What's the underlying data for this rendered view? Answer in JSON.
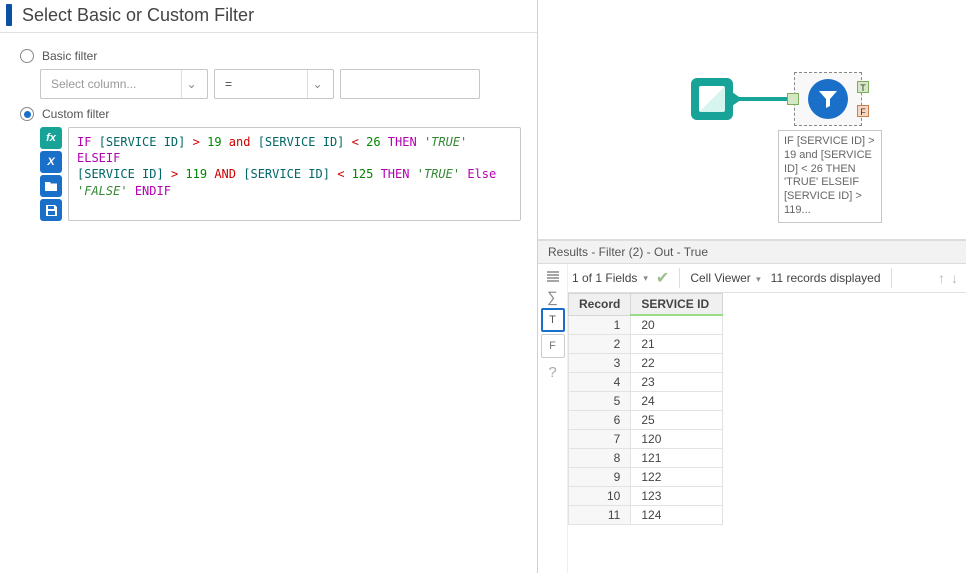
{
  "panel": {
    "title": "Select Basic or Custom Filter",
    "basic_label": "Basic filter",
    "custom_label": "Custom filter",
    "col_placeholder": "Select column...",
    "op_value": "=",
    "expr_tokens": [
      {
        "t": "kw",
        "v": "IF"
      },
      {
        "t": "sp"
      },
      {
        "t": "fldref",
        "v": "[SERVICE ID]"
      },
      {
        "t": "sp"
      },
      {
        "t": "op-t",
        "v": ">"
      },
      {
        "t": "sp"
      },
      {
        "t": "num",
        "v": "19"
      },
      {
        "t": "sp"
      },
      {
        "t": "op-t",
        "v": "and"
      },
      {
        "t": "sp"
      },
      {
        "t": "fldref",
        "v": "[SERVICE ID]"
      },
      {
        "t": "sp"
      },
      {
        "t": "op-t",
        "v": "<"
      },
      {
        "t": "sp"
      },
      {
        "t": "num",
        "v": "26"
      },
      {
        "t": "sp"
      },
      {
        "t": "kw",
        "v": "THEN"
      },
      {
        "t": "sp"
      },
      {
        "t": "str",
        "v": "'TRUE'"
      },
      {
        "t": "sp"
      },
      {
        "t": "kw",
        "v": "ELSEIF"
      },
      {
        "t": "br"
      },
      {
        "t": "fldref",
        "v": "[SERVICE ID]"
      },
      {
        "t": "sp"
      },
      {
        "t": "op-t",
        "v": ">"
      },
      {
        "t": "sp"
      },
      {
        "t": "num",
        "v": "119"
      },
      {
        "t": "sp"
      },
      {
        "t": "op-t",
        "v": "AND"
      },
      {
        "t": "sp"
      },
      {
        "t": "fldref",
        "v": "[SERVICE ID]"
      },
      {
        "t": "sp"
      },
      {
        "t": "op-t",
        "v": "<"
      },
      {
        "t": "sp"
      },
      {
        "t": "num",
        "v": "125"
      },
      {
        "t": "sp"
      },
      {
        "t": "kw",
        "v": "THEN"
      },
      {
        "t": "sp"
      },
      {
        "t": "str",
        "v": "'TRUE'"
      },
      {
        "t": "sp"
      },
      {
        "t": "kw",
        "v": "Else"
      },
      {
        "t": "br"
      },
      {
        "t": "str",
        "v": "'FALSE'"
      },
      {
        "t": "sp"
      },
      {
        "t": "kw",
        "v": "ENDIF"
      }
    ]
  },
  "canvas": {
    "filter_caption": "IF [SERVICE ID] > 19 and [SERVICE ID] < 26 THEN 'TRUE' ELSEIF [SERVICE ID] > 119...",
    "anchor_t": "T",
    "anchor_f": "F"
  },
  "results": {
    "header": "Results - Filter (2) - Out - True",
    "fields_info": "1 of 1 Fields",
    "cell_viewer": "Cell Viewer",
    "records_displayed": "11 records displayed",
    "col_record": "Record",
    "col_service": "SERVICE ID",
    "side": {
      "t": "T",
      "f": "F",
      "q": "?"
    },
    "rows": [
      {
        "r": "1",
        "v": "20"
      },
      {
        "r": "2",
        "v": "21"
      },
      {
        "r": "3",
        "v": "22"
      },
      {
        "r": "4",
        "v": "23"
      },
      {
        "r": "5",
        "v": "24"
      },
      {
        "r": "6",
        "v": "25"
      },
      {
        "r": "7",
        "v": "120"
      },
      {
        "r": "8",
        "v": "121"
      },
      {
        "r": "9",
        "v": "122"
      },
      {
        "r": "10",
        "v": "123"
      },
      {
        "r": "11",
        "v": "124"
      }
    ]
  }
}
